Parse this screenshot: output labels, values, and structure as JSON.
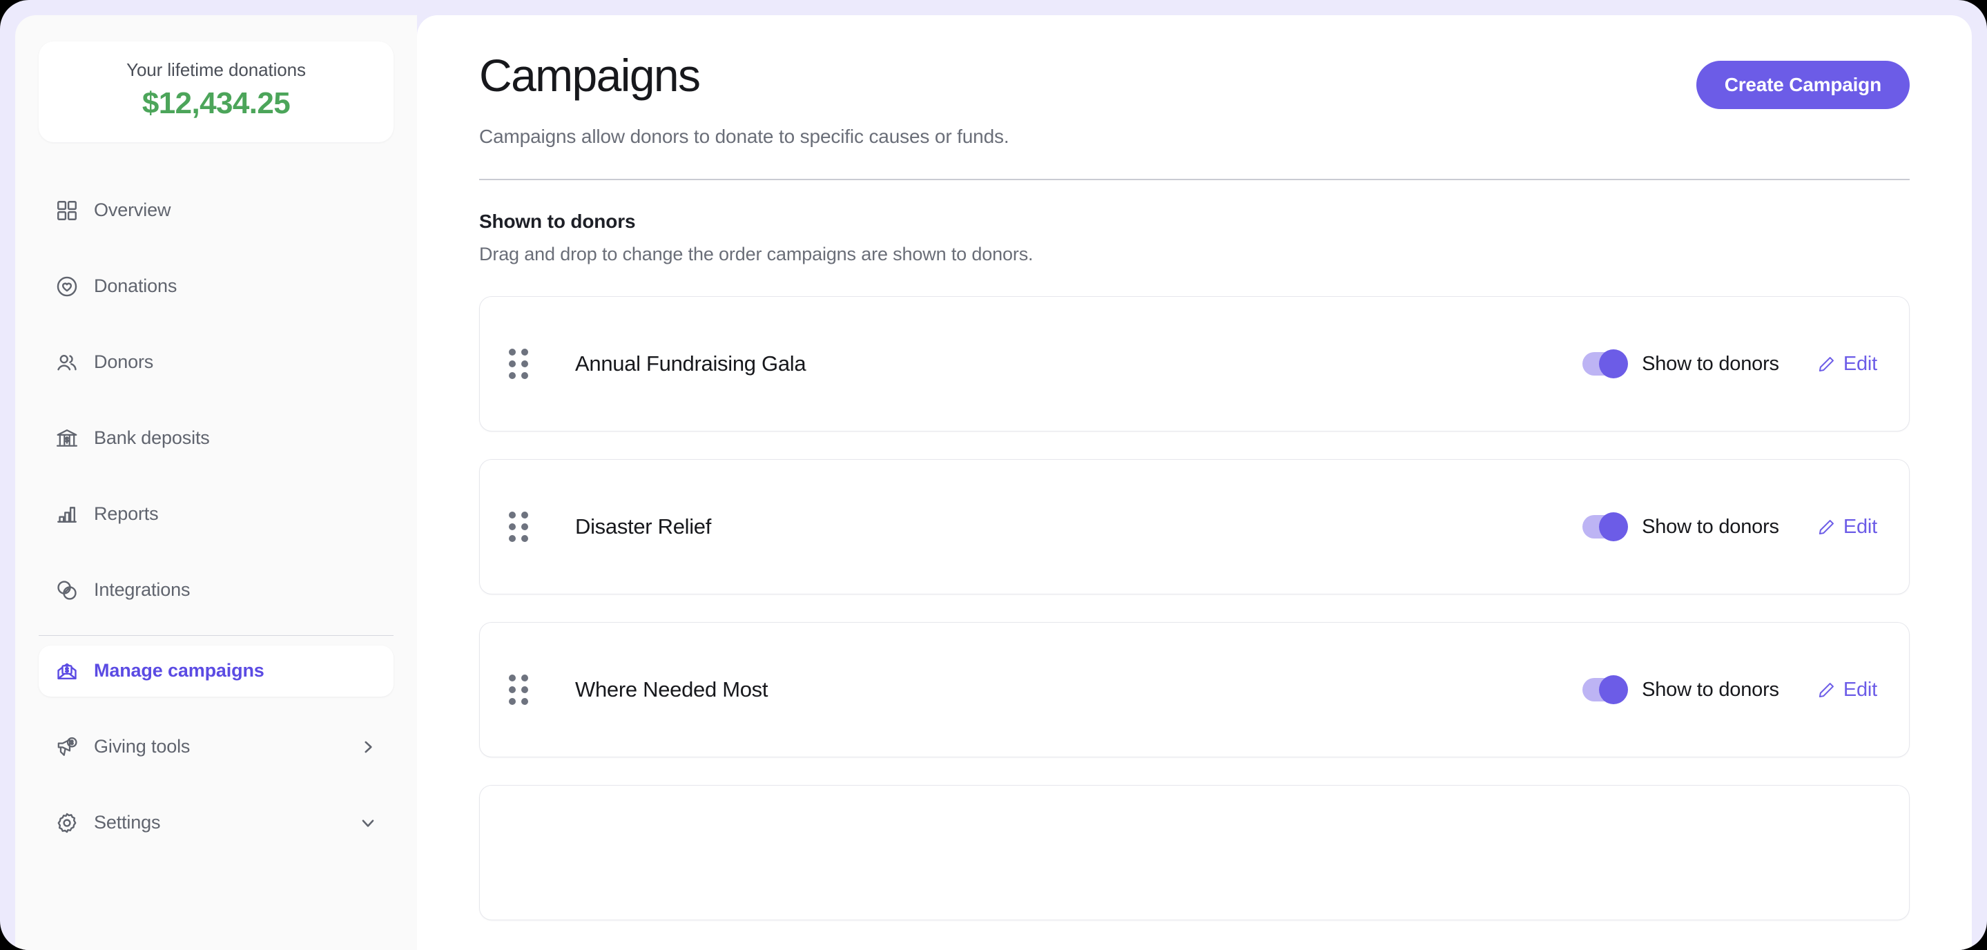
{
  "sidebar": {
    "lifetime_card": {
      "label": "Your lifetime donations",
      "amount": "$12,434.25",
      "amount_color": "#4CA55A"
    },
    "items": [
      {
        "label": "Overview",
        "icon": "grid-icon",
        "active": false,
        "chevron": null
      },
      {
        "label": "Donations",
        "icon": "heart-circle-icon",
        "active": false,
        "chevron": null
      },
      {
        "label": "Donors",
        "icon": "users-icon",
        "active": false,
        "chevron": null
      },
      {
        "label": "Bank deposits",
        "icon": "bank-icon",
        "active": false,
        "chevron": null
      },
      {
        "label": "Reports",
        "icon": "bar-chart-icon",
        "active": false,
        "chevron": null
      },
      {
        "label": "Integrations",
        "icon": "venn-circles-icon",
        "active": false,
        "chevron": null
      },
      {
        "label": "Manage campaigns",
        "icon": "envelope-money-icon",
        "active": true,
        "chevron": null
      },
      {
        "label": "Giving tools",
        "icon": "megaphone-money-icon",
        "active": false,
        "chevron": "chevron-right-icon"
      },
      {
        "label": "Settings",
        "icon": "gear-icon",
        "active": false,
        "chevron": "chevron-down-icon"
      }
    ]
  },
  "main": {
    "title": "Campaigns",
    "subtitle": "Campaigns allow donors to donate to specific causes or funds.",
    "create_button_label": "Create Campaign",
    "create_button_color": "#6C5CE7",
    "section_heading": "Shown to donors",
    "section_description": "Drag and drop to change the order campaigns are shown to donors.",
    "toggle_label": "Show to donors",
    "edit_label": "Edit",
    "campaigns": [
      {
        "name": "Annual Fundraising Gala",
        "show_to_donors": true,
        "toggle_label": "Show to donors",
        "edit_label": "Edit"
      },
      {
        "name": "Disaster Relief",
        "show_to_donors": true,
        "toggle_label": "Show to donors",
        "edit_label": "Edit"
      },
      {
        "name": "Where Needed Most",
        "show_to_donors": true,
        "toggle_label": "Show to donors",
        "edit_label": "Edit"
      }
    ]
  },
  "theme": {
    "page_background": "#ECEAFC",
    "sidebar_background": "#FAFAFA",
    "panel_background": "#FFFFFF",
    "accent": "#6C5CE7",
    "success": "#4CA55A",
    "muted_text": "#6A6E78"
  }
}
